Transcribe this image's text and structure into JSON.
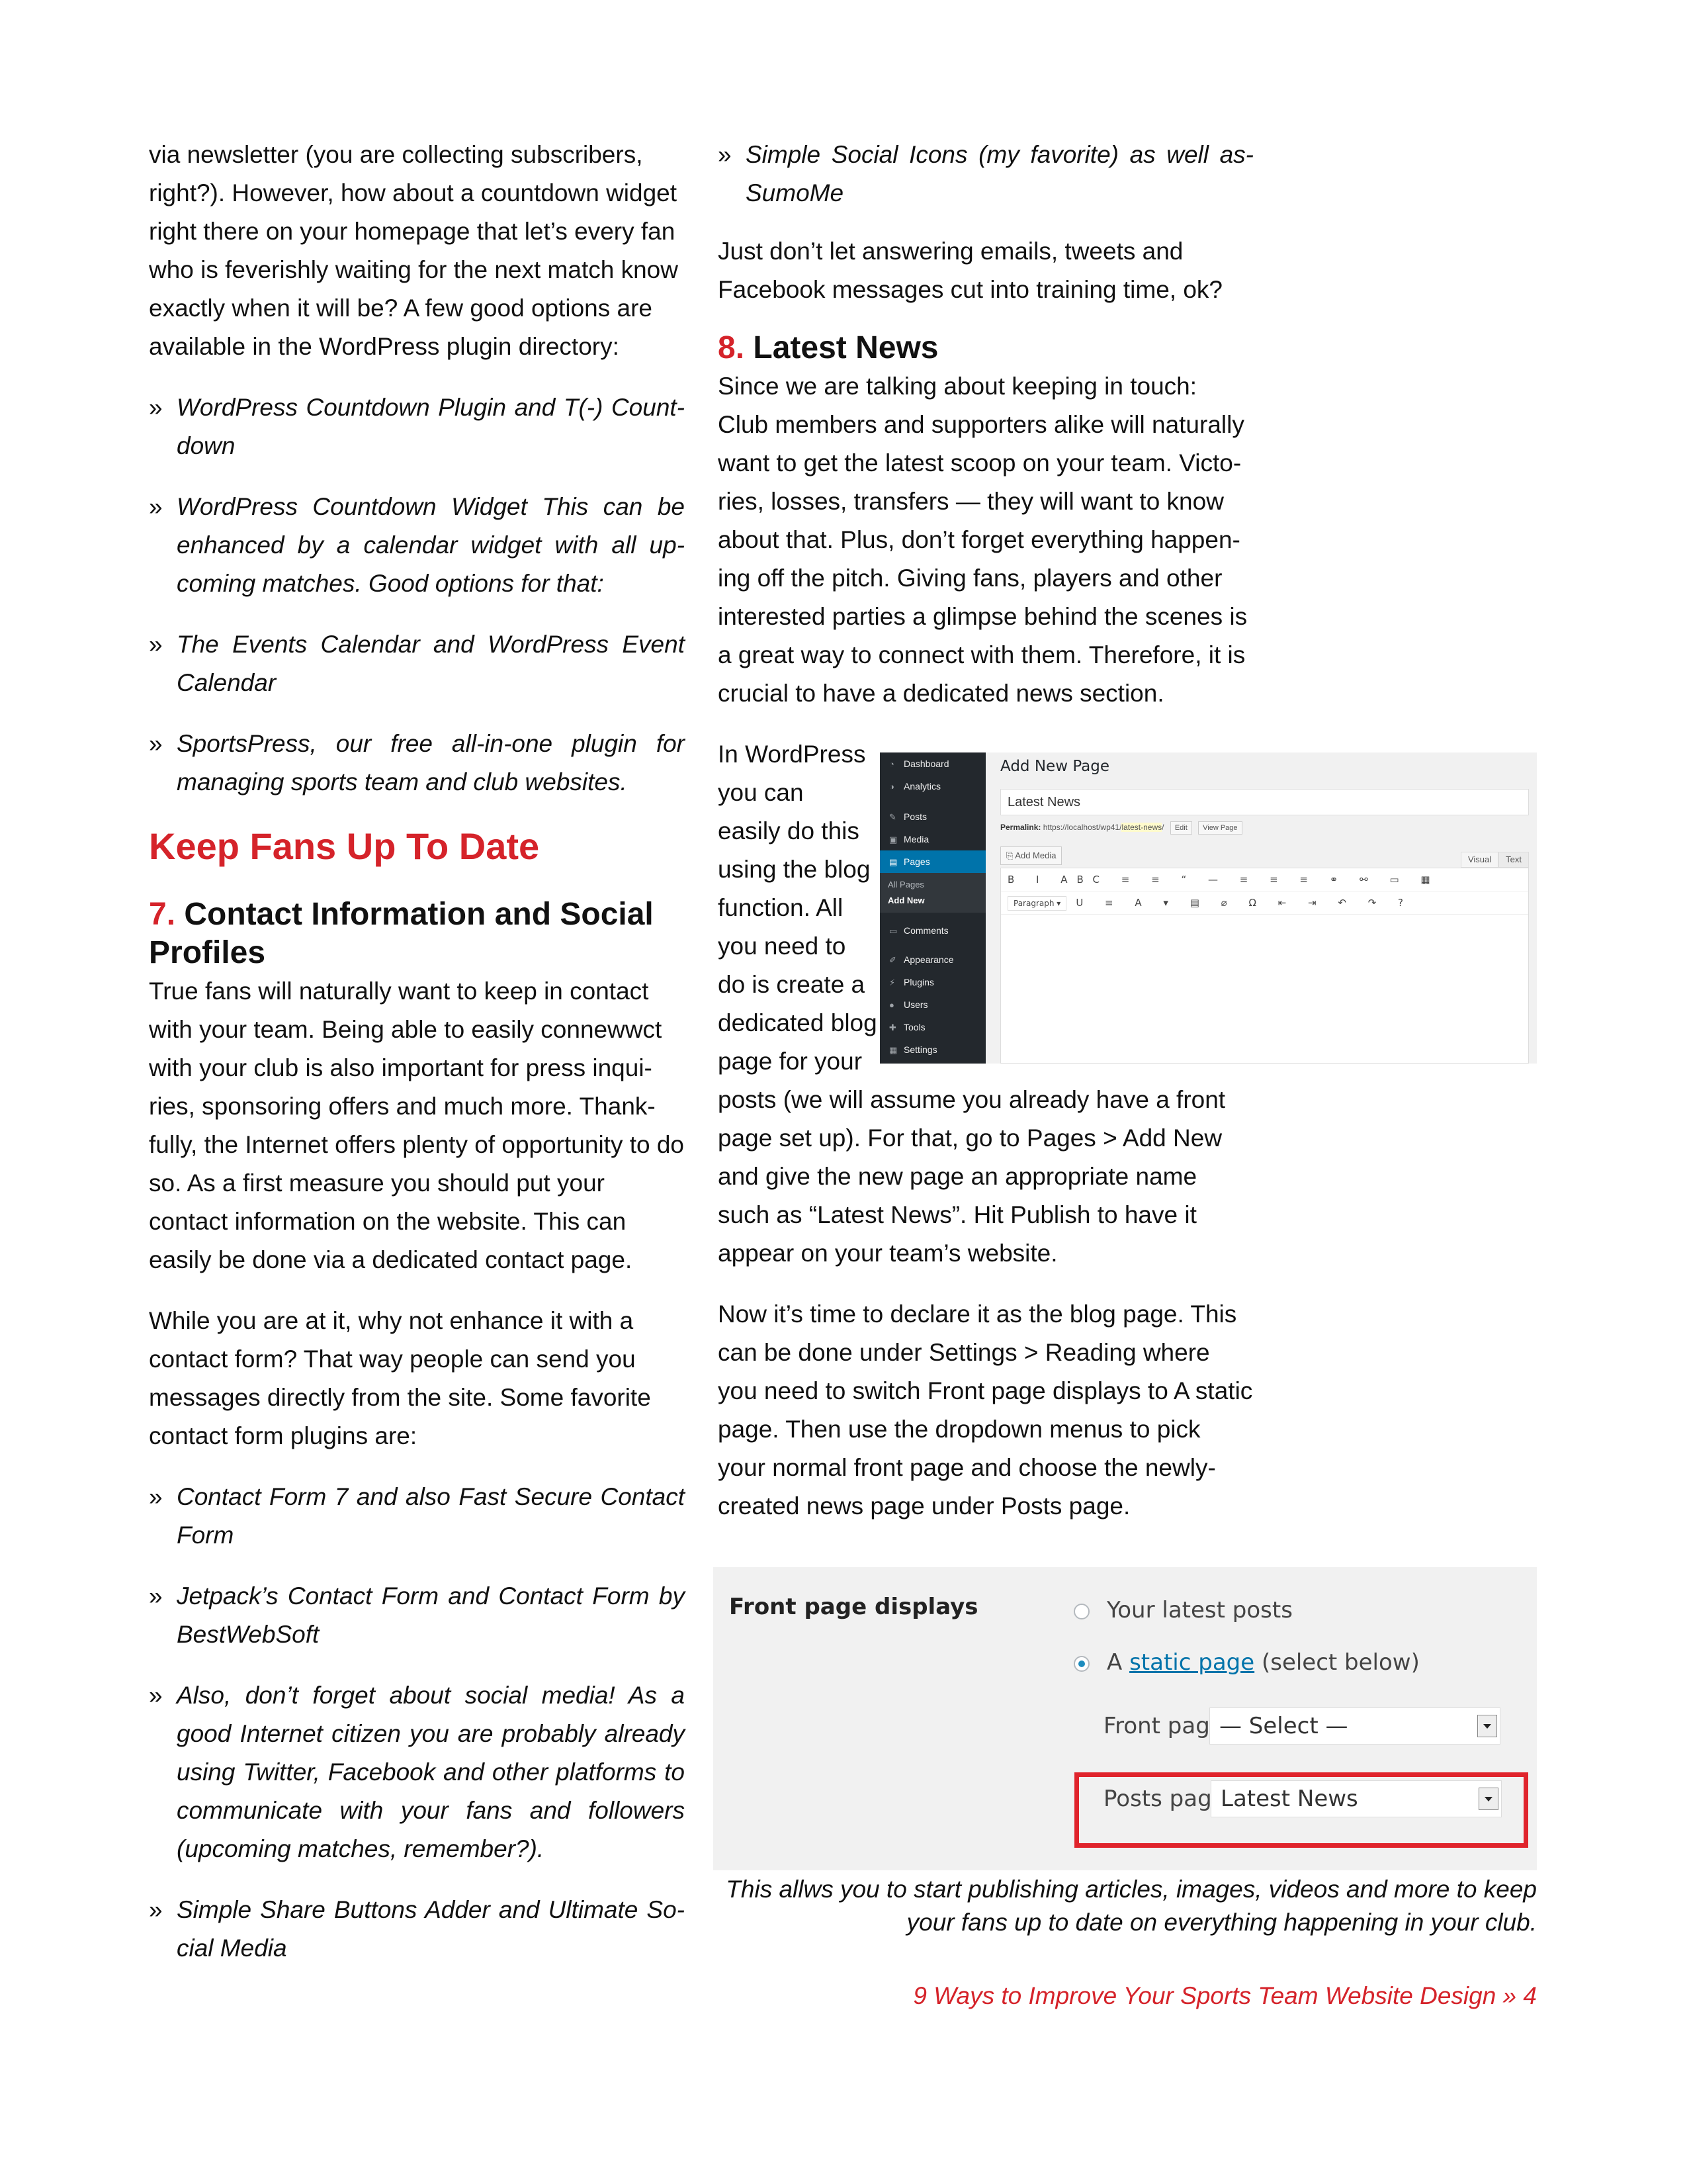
{
  "left_column": {
    "intro": "via newsletter (you are collecting subscribers, right?). However, how about a countdown widget right there on your homepage that let’s every fan who is feverishly waiting for the next match know exactly when it will be? A few good options are available in the WordPress plugin directory:",
    "bullets_countdown": [
      "WordPress Countdown Plugin and T(-) Count-down",
      "WordPress Countdown Widget This can be enhanced by a calendar widget with all up-coming matches. Good options for that:",
      "The Events Calendar and WordPress Event Calendar",
      "SportsPress, our free all-in-one plugin for managing sports team and club websites."
    ],
    "heading_keep_fans": "Keep Fans Up To Date",
    "section7_number": "7.",
    "section7_title": "Contact Information and Social Profiles",
    "section7_para1": "True fans will naturally want to keep in contact with your team. Being able to easily connewwct with your club is also important for press inqui-ries, sponsoring offers and much more. Thank-fully, the Internet offers plenty of opportunity to do so. As a first measure you should put your contact information on the website. This can easily be done via a dedicated contact page.",
    "section7_para2": "While you are at it, why not enhance it with a contact form? That way people can send you messages directly from the site. Some favorite contact form plugins are:",
    "bullets_contact": [
      "Contact Form 7 and also Fast Secure Contact Form",
      "Jetpack’s Contact Form and Contact Form by BestWebSoft",
      "Also, don’t forget about social media! As a good Internet citizen you are probably already using Twitter, Facebook and other platforms to communicate with your fans and followers (upcoming matches, remember?).",
      "Simple Share Buttons Adder and Ultimate So-cial Media"
    ]
  },
  "mid_column": {
    "bullet_social": "Simple Social Icons (my favorite) as well as-SumoMe",
    "para_training": "Just don’t let answering emails, tweets and Facebook messages cut into training time, ok?",
    "section8_number": "8.",
    "section8_title": "Latest News",
    "section8_para1": "Since we are talking about keeping in touch: Club members and supporters alike will naturally want to get the latest scoop on your team. Victo-ries, losses, transfers — they will want to know about that. Plus, don’t forget everything happen-ing off the pitch. Giving fans, players and other interested parties a glimpse behind the scenes is a great way to connect with them. Therefore, it is crucial to have a dedicated news section.",
    "wrap_lines": [
      "In WordPress",
      "you can",
      "easily do this",
      "using the blog",
      "function. All",
      "you need to",
      "do is create a",
      "dedicated blog",
      "page for your"
    ],
    "section8_para2_rest": "posts (we will assume you already have a front page set up). For that, go to Pages > Add New and give the new page an appropriate name such as “Latest News”. Hit Publish to have it appear on your team’s website.",
    "section8_para3": "Now it’s time to declare it as the blog page. This can be done under Settings > Reading where you need to switch Front page displays to A static page. Then use the dropdown menus to pick your normal front page and choose the newly-created news page under Posts page."
  },
  "wp_screenshot": {
    "menu": [
      {
        "label": "Dashboard",
        "icon": "dashboard-icon"
      },
      {
        "label": "Analytics",
        "icon": "analytics-icon"
      },
      {
        "label": "Posts",
        "icon": "pin-icon"
      },
      {
        "label": "Media",
        "icon": "media-icon"
      },
      {
        "label": "Pages",
        "icon": "pages-icon"
      }
    ],
    "submenu": [
      "All Pages",
      "Add New"
    ],
    "menu_lower": [
      {
        "label": "Comments",
        "icon": "comment-icon"
      },
      {
        "label": "Appearance",
        "icon": "brush-icon"
      },
      {
        "label": "Plugins",
        "icon": "plugin-icon"
      },
      {
        "label": "Users",
        "icon": "user-icon"
      },
      {
        "label": "Tools",
        "icon": "wrench-icon"
      },
      {
        "label": "Settings",
        "icon": "settings-icon"
      }
    ],
    "page_title": "Add New Page",
    "title_value": "Latest News",
    "permalink_label": "Permalink:",
    "permalink_base": "https://localhost/wp41/",
    "permalink_slug": "latest-news",
    "permalink_end": "/",
    "edit_label": "Edit",
    "view_label": "View Page",
    "add_media": "Add Media",
    "tab_visual": "Visual",
    "tab_text": "Text",
    "toolbar_row1": "B I ABC ≡ ≡ “ — ≡ ≡ ≡ ⚭ ⚯ ▭ ▦",
    "toolbar_row2_format": "Paragraph ▾",
    "toolbar_row2": "U ≡ A ▾ ▤ ⌀ Ω ⇤ ⇥ ↶ ↷ ?"
  },
  "reading_screenshot": {
    "label": "Front page displays",
    "option_latest": "Your latest posts",
    "option_static_prefix": "A",
    "option_static_link": "static page",
    "option_static_suffix": "(select below)",
    "front_page_label": "Front page:",
    "front_page_value": "— Select —",
    "posts_page_label": "Posts page:",
    "posts_page_value": "Latest News",
    "highlight_color": "#e0242c"
  },
  "caption": "This allws you to start publishing articles, images, videos and more to keep your fans up to date on everything happening in your club.",
  "footer": "9 Ways to Improve Your Sports Team Website Design » 4",
  "colors": {
    "accent": "#d5232a",
    "text": "#111111",
    "wp_sidebar": "#23282d",
    "wp_active": "#0073aa"
  }
}
